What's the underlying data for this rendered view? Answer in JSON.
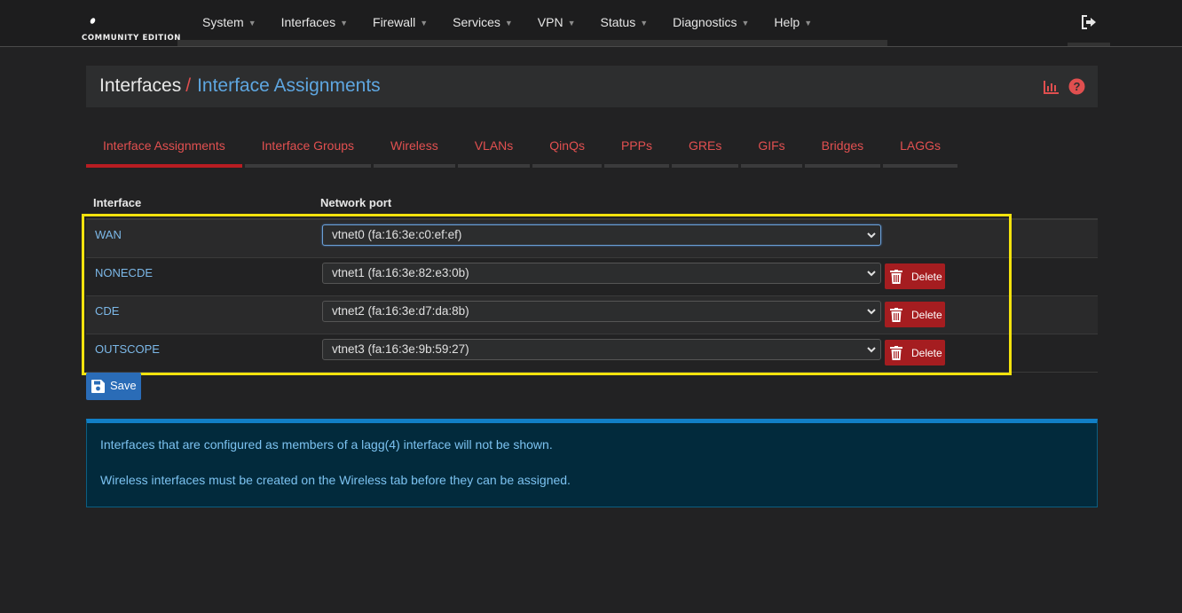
{
  "brand": {
    "edition": "COMMUNITY EDITION"
  },
  "nav": [
    {
      "label": "System"
    },
    {
      "label": "Interfaces"
    },
    {
      "label": "Firewall"
    },
    {
      "label": "Services"
    },
    {
      "label": "VPN"
    },
    {
      "label": "Status"
    },
    {
      "label": "Diagnostics"
    },
    {
      "label": "Help"
    }
  ],
  "breadcrumb": {
    "parent": "Interfaces",
    "separator": "/",
    "current": "Interface Assignments"
  },
  "tabs": [
    {
      "label": "Interface Assignments",
      "active": true
    },
    {
      "label": "Interface Groups"
    },
    {
      "label": "Wireless"
    },
    {
      "label": "VLANs"
    },
    {
      "label": "QinQs"
    },
    {
      "label": "PPPs"
    },
    {
      "label": "GREs"
    },
    {
      "label": "GIFs"
    },
    {
      "label": "Bridges"
    },
    {
      "label": "LAGGs"
    }
  ],
  "table": {
    "headers": {
      "interface": "Interface",
      "port": "Network port"
    },
    "rows": [
      {
        "name": "WAN",
        "port": "vtnet0 (fa:16:3e:c0:ef:ef)"
      },
      {
        "name": "NONECDE",
        "port": "vtnet1 (fa:16:3e:82:e3:0b)",
        "action": "Delete"
      },
      {
        "name": "CDE",
        "port": "vtnet2 (fa:16:3e:d7:da:8b)",
        "action": "Delete"
      },
      {
        "name": "OUTSCOPE",
        "port": "vtnet3 (fa:16:3e:9b:59:27)",
        "action": "Delete"
      }
    ]
  },
  "save_label": "Save",
  "info": {
    "line1": "Interfaces that are configured as members of a lagg(4) interface will not be shown.",
    "line2": "Wireless interfaces must be created on the Wireless tab before they can be assigned."
  },
  "colors": {
    "accent_red": "#e25050",
    "link_blue": "#5ea6e0",
    "highlight": "#f3e20d",
    "delete": "#a51d20",
    "save": "#2a6cb7"
  }
}
